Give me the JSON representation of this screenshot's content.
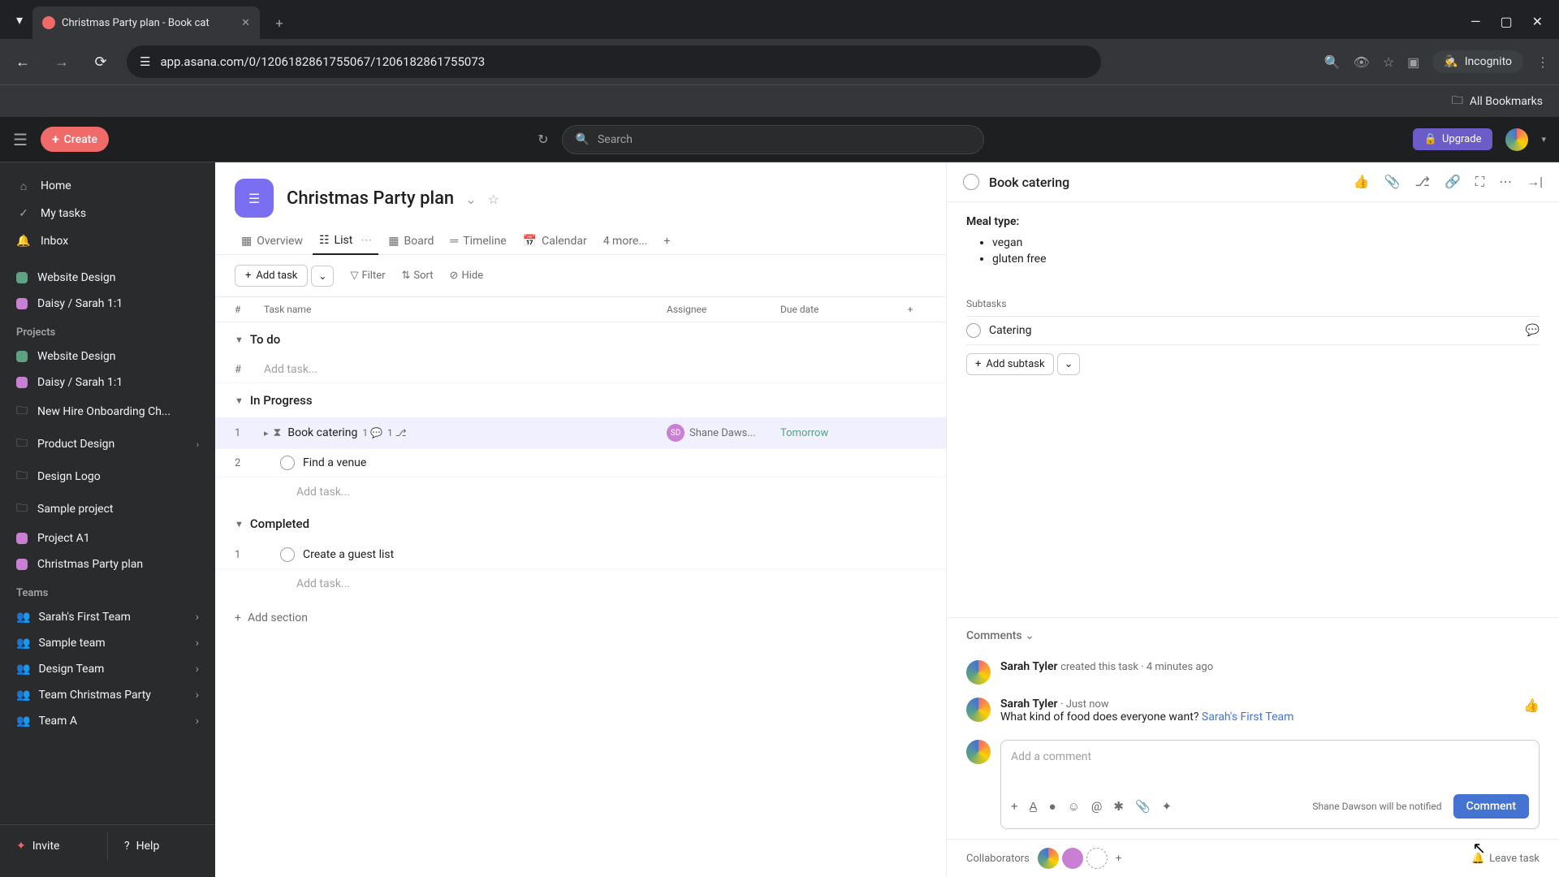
{
  "browser": {
    "tab_title": "Christmas Party plan - Book cat",
    "url": "app.asana.com/0/1206182861755067/1206182861755073",
    "incognito": "Incognito",
    "all_bookmarks": "All Bookmarks"
  },
  "header": {
    "create": "Create",
    "search_placeholder": "Search",
    "upgrade": "Upgrade"
  },
  "sidebar": {
    "home": "Home",
    "my_tasks": "My tasks",
    "inbox": "Inbox",
    "recent": [
      {
        "label": "Website Design",
        "color": "#5da283"
      },
      {
        "label": "Daisy / Sarah 1:1",
        "color": "#c97fd4"
      }
    ],
    "projects_label": "Projects",
    "projects": [
      {
        "label": "Website Design",
        "color": "#5da283",
        "type": "dot"
      },
      {
        "label": "Daisy / Sarah 1:1",
        "color": "#c97fd4",
        "type": "dot"
      },
      {
        "label": "New Hire Onboarding Ch...",
        "type": "folder"
      },
      {
        "label": "Product Design",
        "type": "folder",
        "chevron": true
      },
      {
        "label": "Design Logo",
        "type": "folder"
      },
      {
        "label": "Sample project",
        "type": "folder"
      },
      {
        "label": "Project A1",
        "color": "#c97fd4",
        "type": "dot"
      },
      {
        "label": "Christmas Party plan",
        "color": "#c97fd4",
        "type": "dot"
      }
    ],
    "teams_label": "Teams",
    "teams": [
      "Sarah's First Team",
      "Sample team",
      "Design Team",
      "Team Christmas Party",
      "Team A"
    ],
    "invite": "Invite",
    "help": "Help"
  },
  "project": {
    "title": "Christmas Party plan",
    "tabs": {
      "overview": "Overview",
      "list": "List",
      "board": "Board",
      "timeline": "Timeline",
      "calendar": "Calendar",
      "more": "4 more..."
    },
    "toolbar": {
      "add_task": "Add task",
      "filter": "Filter",
      "sort": "Sort",
      "hide": "Hide"
    },
    "columns": {
      "num": "#",
      "name": "Task name",
      "assignee": "Assignee",
      "due": "Due date"
    },
    "sections": {
      "todo": "To do",
      "in_progress": "In Progress",
      "completed": "Completed"
    },
    "tasks": {
      "book_catering": {
        "num": "1",
        "name": "Book catering",
        "comments": "1",
        "subtasks": "1",
        "assignee": "Shane Daws...",
        "assignee_initials": "SD",
        "due": "Tomorrow"
      },
      "find_venue": {
        "num": "2",
        "name": "Find a venue"
      },
      "guest_list": {
        "num": "1",
        "name": "Create a guest list"
      }
    },
    "add_task_placeholder": "Add task...",
    "add_section": "Add section",
    "todo_num": "#"
  },
  "detail": {
    "title": "Book catering",
    "meal_type_label": "Meal type:",
    "meals": [
      "vegan",
      "gluten free"
    ],
    "subtasks_label": "Subtasks",
    "subtask_name": "Catering",
    "add_subtask": "Add subtask",
    "comments_label": "Comments",
    "activity": {
      "author": "Sarah Tyler",
      "action": "created this task",
      "time": "4 minutes ago"
    },
    "comment1": {
      "author": "Sarah Tyler",
      "time": "Just now",
      "text": "What kind of food does everyone want? ",
      "mention": "Sarah's First Team"
    },
    "comment_placeholder": "Add a comment",
    "notify_text": "Shane Dawson will be notified",
    "comment_btn": "Comment",
    "collaborators": "Collaborators",
    "leave_task": "Leave task"
  }
}
